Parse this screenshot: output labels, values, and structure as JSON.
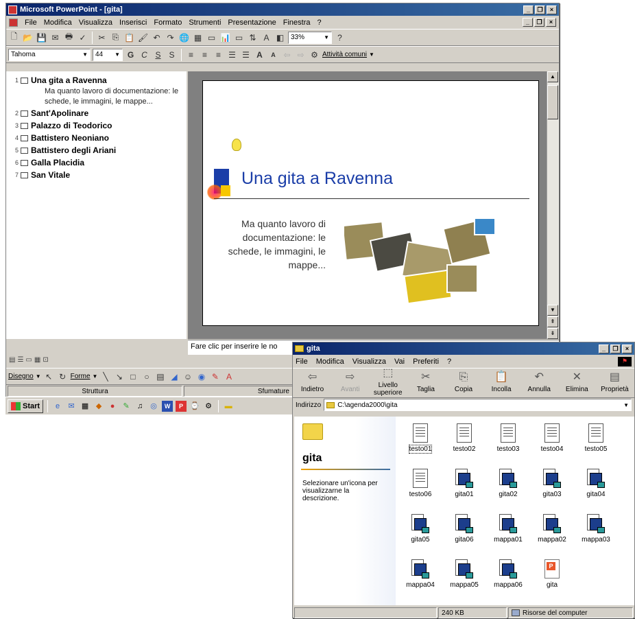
{
  "ppt": {
    "title": "Microsoft PowerPoint - [gita]",
    "menus": [
      "File",
      "Modifica",
      "Visualizza",
      "Inserisci",
      "Formato",
      "Strumenti",
      "Presentazione",
      "Finestra",
      "?"
    ],
    "font_name": "Tahoma",
    "font_size": "44",
    "zoom": "33%",
    "format_buttons": [
      "G",
      "C",
      "S",
      "S"
    ],
    "common_tasks": "Attività comuni",
    "outline": [
      {
        "num": "1",
        "title": "Una gita a Ravenna",
        "body": "Ma quanto lavoro di documentazione: le schede, le immagini, le mappe..."
      },
      {
        "num": "2",
        "title": "Sant'Apolinare"
      },
      {
        "num": "3",
        "title": "Palazzo di Teodorico"
      },
      {
        "num": "4",
        "title": "Battistero Neoniano"
      },
      {
        "num": "5",
        "title": "Battistero degli Ariani"
      },
      {
        "num": "6",
        "title": "Galla Placidia"
      },
      {
        "num": "7",
        "title": "San Vitale"
      }
    ],
    "slide_title": "Una gita a Ravenna",
    "slide_body": "Ma quanto lavoro di documentazione: le schede, le immagini, le mappe...",
    "notes_placeholder": "Fare clic per inserire le no",
    "draw_menu": "Disegno",
    "shapes_menu": "Forme",
    "status_left": "Struttura",
    "status_right": "Sfumature"
  },
  "taskbar": {
    "start": "Start"
  },
  "explorer": {
    "title": "gita",
    "menus": [
      "File",
      "Modifica",
      "Visualizza",
      "Vai",
      "Preferiti",
      "?"
    ],
    "toolbar": [
      "Indietro",
      "Avanti",
      "Livello superiore",
      "Taglia",
      "Copia",
      "Incolla",
      "Annulla",
      "Elimina",
      "Proprietà"
    ],
    "address_label": "Indirizzo",
    "address": "C:\\agenda2000\\gita",
    "folder_name": "gita",
    "folder_hint": "Selezionare un'icona per visualizzarne la descrizione.",
    "files": [
      {
        "name": "testo01",
        "kind": "doc"
      },
      {
        "name": "testo02",
        "kind": "doc"
      },
      {
        "name": "testo03",
        "kind": "doc"
      },
      {
        "name": "testo04",
        "kind": "doc"
      },
      {
        "name": "testo05",
        "kind": "doc"
      },
      {
        "name": "testo06",
        "kind": "doc"
      },
      {
        "name": "gita01",
        "kind": "img"
      },
      {
        "name": "gita02",
        "kind": "img"
      },
      {
        "name": "gita03",
        "kind": "img"
      },
      {
        "name": "gita04",
        "kind": "img"
      },
      {
        "name": "gita05",
        "kind": "img"
      },
      {
        "name": "gita06",
        "kind": "img"
      },
      {
        "name": "mappa01",
        "kind": "img"
      },
      {
        "name": "mappa02",
        "kind": "img"
      },
      {
        "name": "mappa03",
        "kind": "img"
      },
      {
        "name": "mappa04",
        "kind": "img"
      },
      {
        "name": "mappa05",
        "kind": "img"
      },
      {
        "name": "mappa06",
        "kind": "img"
      },
      {
        "name": "gita",
        "kind": "ppt"
      }
    ],
    "status_size": "240 KB",
    "status_location": "Risorse del computer"
  }
}
